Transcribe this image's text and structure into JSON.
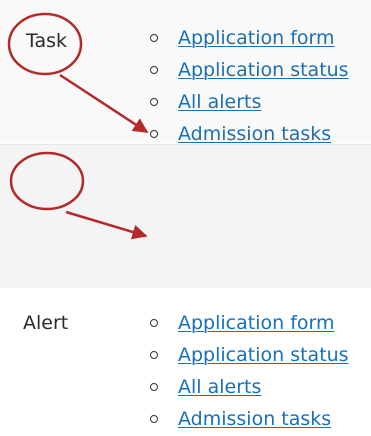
{
  "colors": {
    "link": "#1a6fb6",
    "annotation": "#b22a2a",
    "text": "#2b2b2b"
  },
  "task_row": {
    "label": "Task",
    "links": [
      "Application form",
      "Application status",
      "All alerts",
      "Admission tasks"
    ]
  },
  "alert_row": {
    "label": "Alert",
    "links": [
      "Application form",
      "Application status",
      "All alerts",
      "Admission tasks"
    ]
  }
}
